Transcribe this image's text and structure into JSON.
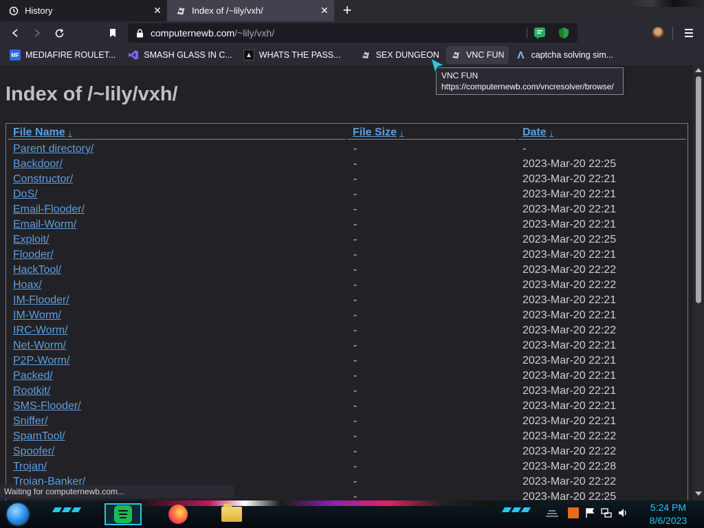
{
  "browser": {
    "tabs": [
      {
        "title": "History",
        "icon": "history-icon"
      },
      {
        "title": "Index of /~lily/vxh/",
        "icon": "site-icon"
      }
    ],
    "new_tab_label": "+",
    "url_domain": "computernewb.com",
    "url_path": "/~lily/vxh/",
    "bookmarks": [
      {
        "label": "MEDIAFIRE ROULET...",
        "icon": "mediafire-icon",
        "icon_text": "MF"
      },
      {
        "label": "SMASH GLASS IN C...",
        "icon": "visualstudio-icon",
        "icon_text": ""
      },
      {
        "label": "WHATS THE PASS...",
        "icon": "dark-site-icon",
        "icon_text": ""
      },
      {
        "label": "SEX DUNGEON",
        "icon": "site-icon",
        "icon_text": ""
      },
      {
        "label": "VNC FUN",
        "icon": "site-icon",
        "icon_text": ""
      },
      {
        "label": "captcha solving sim...",
        "icon": "lambda-icon",
        "icon_text": "Λ"
      }
    ],
    "tooltip": {
      "title": "VNC FUN",
      "url": "https://computernewb.com/vncresolver/browse/"
    },
    "status_text": "Waiting for computernewb.com..."
  },
  "page": {
    "title": "Index of /~lily/vxh/",
    "columns": {
      "name": "File Name",
      "size": "File Size",
      "date": "Date",
      "sort_arrow": "↓"
    },
    "rows": [
      {
        "name": "Parent directory/",
        "size": "-",
        "date": "-"
      },
      {
        "name": "Backdoor/",
        "size": "-",
        "date": "2023-Mar-20 22:25"
      },
      {
        "name": "Constructor/",
        "size": "-",
        "date": "2023-Mar-20 22:21"
      },
      {
        "name": "DoS/",
        "size": "-",
        "date": "2023-Mar-20 22:21"
      },
      {
        "name": "Email-Flooder/",
        "size": "-",
        "date": "2023-Mar-20 22:21"
      },
      {
        "name": "Email-Worm/",
        "size": "-",
        "date": "2023-Mar-20 22:21"
      },
      {
        "name": "Exploit/",
        "size": "-",
        "date": "2023-Mar-20 22:25"
      },
      {
        "name": "Flooder/",
        "size": "-",
        "date": "2023-Mar-20 22:21"
      },
      {
        "name": "HackTool/",
        "size": "-",
        "date": "2023-Mar-20 22:22"
      },
      {
        "name": "Hoax/",
        "size": "-",
        "date": "2023-Mar-20 22:22"
      },
      {
        "name": "IM-Flooder/",
        "size": "-",
        "date": "2023-Mar-20 22:21"
      },
      {
        "name": "IM-Worm/",
        "size": "-",
        "date": "2023-Mar-20 22:21"
      },
      {
        "name": "IRC-Worm/",
        "size": "-",
        "date": "2023-Mar-20 22:22"
      },
      {
        "name": "Net-Worm/",
        "size": "-",
        "date": "2023-Mar-20 22:21"
      },
      {
        "name": "P2P-Worm/",
        "size": "-",
        "date": "2023-Mar-20 22:21"
      },
      {
        "name": "Packed/",
        "size": "-",
        "date": "2023-Mar-20 22:21"
      },
      {
        "name": "Rootkit/",
        "size": "-",
        "date": "2023-Mar-20 22:21"
      },
      {
        "name": "SMS-Flooder/",
        "size": "-",
        "date": "2023-Mar-20 22:21"
      },
      {
        "name": "Sniffer/",
        "size": "-",
        "date": "2023-Mar-20 22:21"
      },
      {
        "name": "SpamTool/",
        "size": "-",
        "date": "2023-Mar-20 22:22"
      },
      {
        "name": "Spoofer/",
        "size": "-",
        "date": "2023-Mar-20 22:22"
      },
      {
        "name": "Trojan/",
        "size": "-",
        "date": "2023-Mar-20 22:28"
      },
      {
        "name": "Trojan-Banker/",
        "size": "-",
        "date": "2023-Mar-20 22:22"
      },
      {
        "name": "",
        "size": "-",
        "date": "2023-Mar-20 22:25"
      }
    ]
  },
  "taskbar": {
    "time": "5:24 PM",
    "date": "8/6/2023",
    "apps": [
      "spotify-icon",
      "firefox-icon",
      "file-explorer-icon"
    ]
  },
  "colors": {
    "link": "#5e9fe0",
    "accent": "#29c5f6",
    "page_bg": "#222125"
  }
}
